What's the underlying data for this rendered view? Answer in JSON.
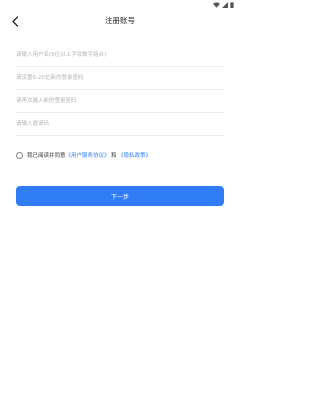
{
  "header": {
    "title": "注册账号",
    "back_icon": "chevron-left-icon"
  },
  "status_bar": {
    "icons": [
      "wifi-icon",
      "signal-icon",
      "battery-icon"
    ]
  },
  "form": {
    "username_placeholder": "请输入用户名(5位以上字母数字组合)",
    "password_placeholder": "请设置6-20位新的登录密码",
    "confirm_password_placeholder": "请再次输入新的登录密码",
    "invite_code_placeholder": "请输入邀请码"
  },
  "agreement": {
    "prefix": "我已阅读并同意",
    "user_agreement": "《用户服务协议》",
    "conjunction": "和",
    "privacy_policy": "《隐私政策》",
    "checked": false
  },
  "actions": {
    "next_label": "下一步"
  },
  "colors": {
    "accent": "#2f7cf6",
    "placeholder": "#b3b3b3",
    "divider": "#ececec"
  }
}
